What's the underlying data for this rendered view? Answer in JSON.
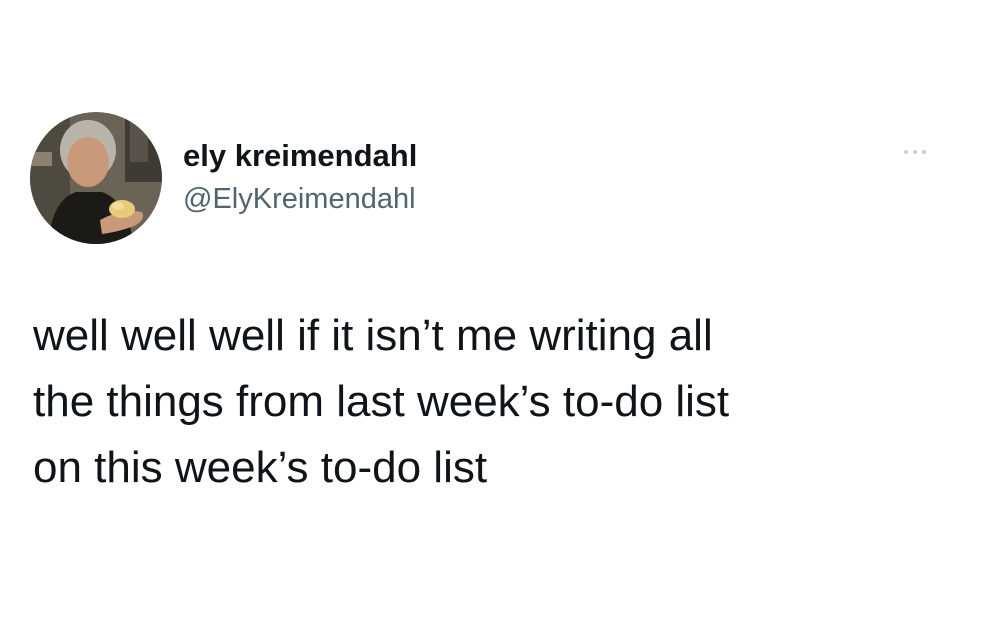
{
  "author": {
    "display_name": "ely kreimendahl",
    "handle": "@ElyKreimendahl"
  },
  "menu": {
    "icon": "more-horizontal-icon"
  },
  "tweet": {
    "lines": [
      "well well well if it isn’t me writing all",
      "the things from last week’s to-do list",
      "on this week’s to-do list"
    ]
  },
  "colors": {
    "text": "#0f1419",
    "handle": "#536471",
    "menu_dots": "#c9cfd4",
    "background": "#ffffff"
  }
}
